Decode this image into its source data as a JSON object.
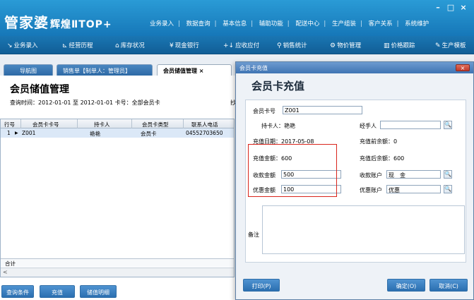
{
  "app": {
    "brand": "管家婆",
    "brand_sub": "辉煌ⅡTOP+",
    "window_controls": [
      "–",
      "□",
      "×"
    ],
    "top_menu": [
      "业务录入",
      "数据查询",
      "基本信息",
      "辅助功能",
      "配送中心",
      "生产组装",
      "客户关系",
      "系统维护"
    ]
  },
  "toolbar": [
    {
      "icon": "业务录入-icon",
      "label": "业务录入"
    },
    {
      "icon": "经营历程-icon",
      "label": "经营历程"
    },
    {
      "icon": "库存状况-icon",
      "label": "库存状况"
    },
    {
      "icon": "现金银行-icon",
      "label": "现金银行"
    },
    {
      "icon": "应收应付-icon",
      "label": "应收应付"
    },
    {
      "icon": "销售统计-icon",
      "label": "销售统计"
    },
    {
      "icon": "物价管理-icon",
      "label": "物价管理"
    },
    {
      "icon": "价格跟踪-icon",
      "label": "价格跟踪"
    },
    {
      "icon": "生产模板-icon",
      "label": "生产模板"
    }
  ],
  "tabs": [
    "导航图",
    "销售单【制单人：管理员】",
    "会员储值管理 ×"
  ],
  "page": {
    "title": "会员储值管理",
    "query": "查询时间：2012-01-01 至 2012-01-01 卡号：全部会员卡",
    "fragment": "抄"
  },
  "grid": {
    "columns": [
      "行号",
      "会员卡卡号",
      "持卡人",
      "会员卡类型",
      "联系人电话"
    ],
    "rows": [
      {
        "row": "1",
        "card": "Z001",
        "holder": "艳艳",
        "type": "会员卡",
        "phone": "04552703650"
      }
    ],
    "total_label": "合计"
  },
  "bottom_buttons": [
    "查询条件",
    "充值",
    "储值明细"
  ],
  "dialog": {
    "title": "会员卡充值",
    "heading": "会员卡充值",
    "card_no_label": "会员卡号",
    "card_no_value": "Z001",
    "holder_label": "持卡人：艳艳",
    "handler_label": "经手人",
    "handler_value": "",
    "date_label": "充值日期：2017-05-08",
    "before_balance_label": "充值前余额：0",
    "amount_label": "充值金额：600",
    "after_balance_label": "充值后余额：600",
    "received_label": "收款金额",
    "received_value": "500",
    "received_account_label": "收款账户",
    "received_account_value": "现　金",
    "discount_label": "优惠金额",
    "discount_value": "100",
    "discount_account_label": "优惠账户",
    "discount_account_value": "优惠",
    "memo_label": "备注",
    "print_button": "打印(P)",
    "ok_button": "确定(O)",
    "cancel_button": "取消(C)",
    "close": "×"
  },
  "colors": {
    "brand_blue": "#1677b8",
    "highlight_box": "#d9251c",
    "selected_row": "#dbe8f7"
  }
}
